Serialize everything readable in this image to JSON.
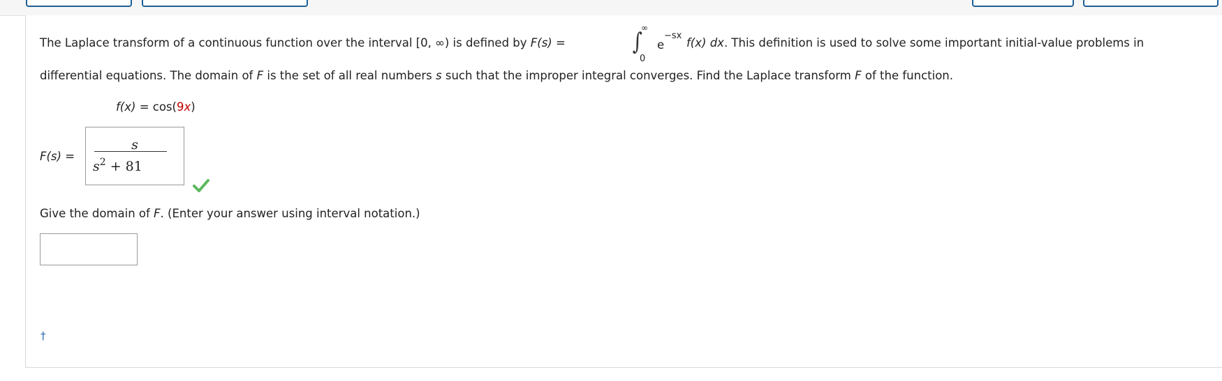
{
  "intro": {
    "text_before_interval": "The Laplace transform of a continuous function over the interval ",
    "interval": "[0, ∞)",
    "text_defined_by": " is defined by ",
    "F_of_s": "F(s)",
    "equals": " =",
    "integral_upper": "∞",
    "integral_lower": "0",
    "exp_base": "e",
    "exp_power": "−sx",
    "integrand": " f(x) dx",
    "text_after_integral": ". This definition is used to solve some important initial-value problems in",
    "line2_a": "differential equations. The domain of ",
    "line2_F": "F",
    "line2_b": " is the set of all real numbers ",
    "line2_s": "s",
    "line2_c": " such that the improper integral converges. Find the Laplace transform ",
    "line2_F2": "F",
    "line2_d": " of the function."
  },
  "function_def": {
    "lhs": "f(x)",
    "eq": " = cos(",
    "coef": "9",
    "var": "x",
    "close": ")"
  },
  "answer1": {
    "label": "F(s)",
    "label_eq": " =",
    "numerator": "s",
    "den_var": "s",
    "den_exp": "2",
    "den_rest": " + 81",
    "status": "correct"
  },
  "question2": {
    "prefix": "Give the domain of ",
    "F": "F",
    "suffix": ". (Enter your answer using interval notation.)",
    "input_value": ""
  },
  "footnote": {
    "symbol": "†"
  },
  "colors": {
    "accent": "#1f5f95",
    "correct": "#5cb85c",
    "highlight": "#c00000"
  }
}
